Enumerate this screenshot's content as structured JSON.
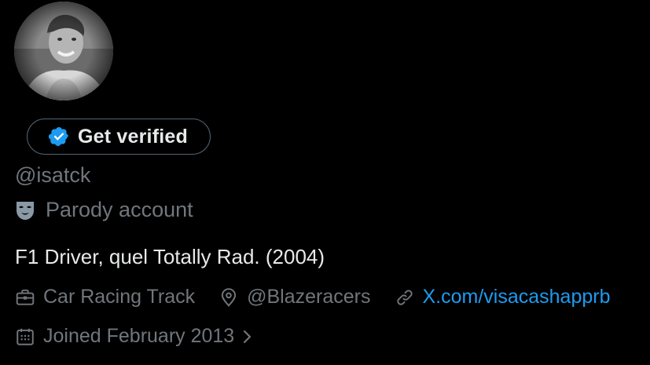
{
  "profile": {
    "avatar_icon": "profile-photo-avatar",
    "verify_button_label": "Get verified",
    "verify_badge_icon": "verified-badge-icon",
    "handle": "@isatck",
    "parody_label": "Parody account",
    "parody_icon": "theater-mask-icon",
    "bio": "F1 Driver, quel Totally Rad. (2004)",
    "category": "Car Racing Track",
    "category_icon": "briefcase-icon",
    "location": "@Blazeracers",
    "location_icon": "location-pin-icon",
    "website": "X.com/visacashapprb",
    "website_icon": "link-icon",
    "joined": "Joined February 2013",
    "joined_icon": "calendar-icon",
    "joined_chevron_icon": "chevron-right-icon"
  },
  "colors": {
    "background": "#000000",
    "text_primary": "#e7e9ea",
    "text_secondary": "#71767b",
    "accent_blue": "#1d9bf0",
    "button_border": "#536471"
  }
}
